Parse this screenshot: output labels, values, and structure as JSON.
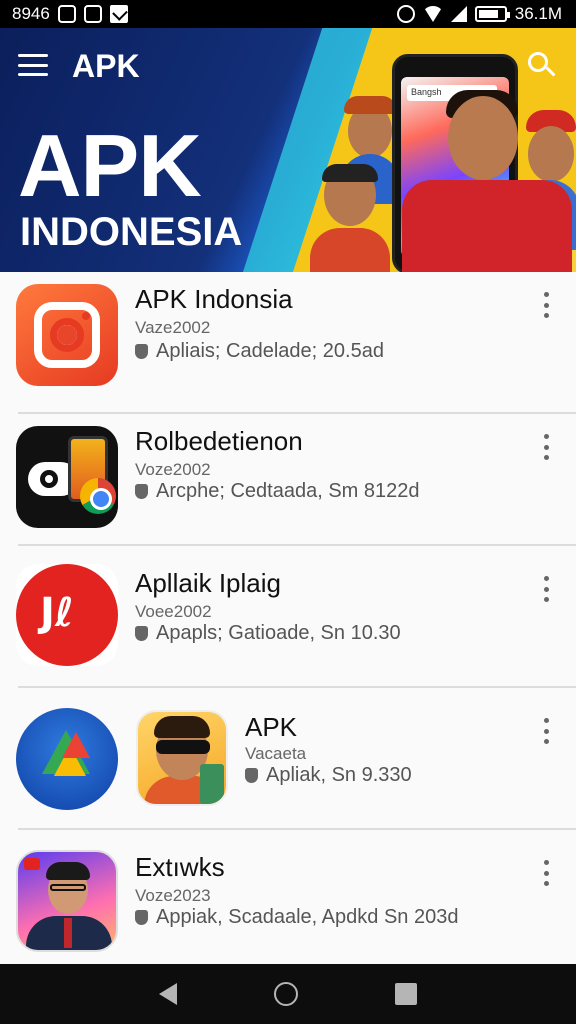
{
  "status_bar": {
    "time": "8946",
    "battery_text": "36.1M",
    "battery_level": 0.8,
    "icons": [
      "alarm-icon",
      "cast-icon",
      "mail-icon",
      "silent-icon",
      "wifi-icon",
      "signal-icon",
      "battery-icon"
    ]
  },
  "header": {
    "app_title": "APK",
    "hero_title": "APK",
    "hero_subtitle": "INDONESIA",
    "colors": {
      "primary": "#13307a",
      "accent": "#f5c518",
      "cyan": "#2bb8d9"
    }
  },
  "apps": [
    {
      "name": "APK Indonsia",
      "version": "Vaze2002",
      "meta": "Apliais; Cadelade; 20.5ad",
      "icon": "camera-app-icon"
    },
    {
      "name": "Rolbedetienon",
      "version": "Voze2002",
      "meta": "Arcphe; Cedtaada, Sm 8122d",
      "icon": "browser-app-icon"
    },
    {
      "name": "Apllaik Iplaig",
      "version": "Voee2002",
      "meta": "Apapls; Gatioade, Sn 10.30",
      "icon": "red-app-icon"
    },
    {
      "name": "APK",
      "version": "Vacaeta",
      "meta": "Apliak, Sn 9.330",
      "icon": "maps-app-icon"
    },
    {
      "name": "Extıwks",
      "version": "Voze2023",
      "meta": "Appiak, Scadaale, Apdkd Sn 203d",
      "icon": "news-app-icon"
    }
  ]
}
